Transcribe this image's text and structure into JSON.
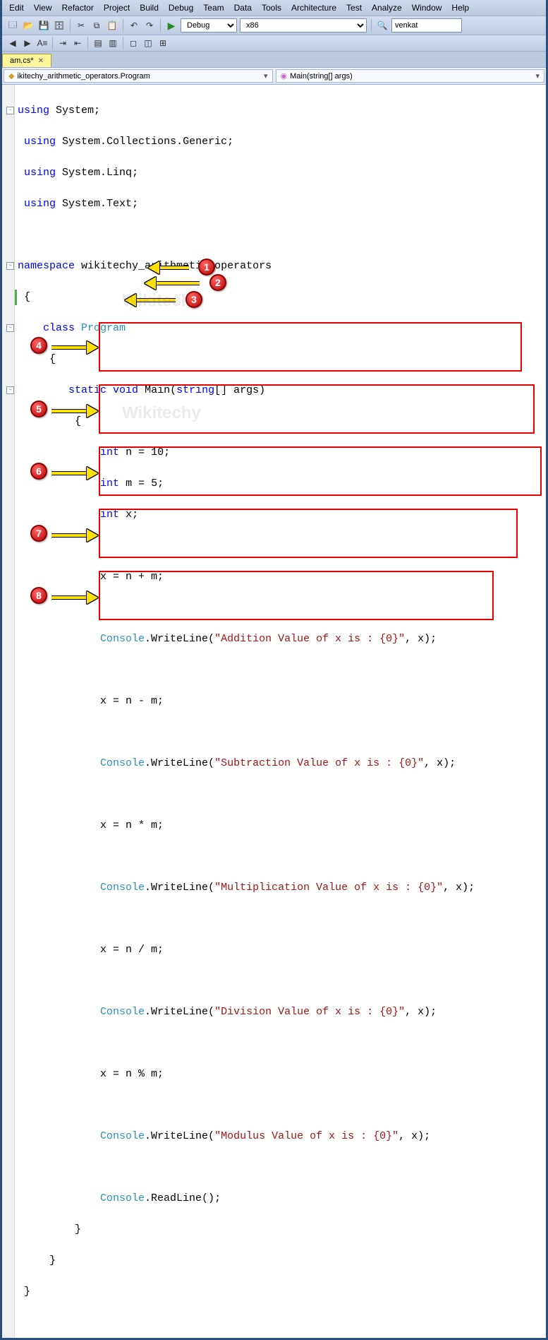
{
  "menu": [
    "Edit",
    "View",
    "Refactor",
    "Project",
    "Build",
    "Debug",
    "Team",
    "Data",
    "Tools",
    "Architecture",
    "Test",
    "Analyze",
    "Window",
    "Help"
  ],
  "toolbar": {
    "config_select": "Debug",
    "platform_select": "x86",
    "search_value": "venkat"
  },
  "tab": {
    "name": "am.cs*"
  },
  "nav": {
    "left": "ikitechy_arithmetic_operators.Program",
    "right": "Main(string[] args)"
  },
  "code": {
    "using1": "System",
    "using2": "System.Collections.Generic",
    "using3": "System.Linq",
    "using4": "System.Text",
    "ns": "wikitechy_arithmetic_operators",
    "cls": "Program",
    "mainSig": {
      "kw1": "static",
      "kw2": "void",
      "name": "Main",
      "argType": "string",
      "argName": "args"
    },
    "decl1": {
      "t": "int",
      "v": "n = 10;"
    },
    "decl2": {
      "t": "int",
      "v": "m = 5;"
    },
    "decl3": {
      "t": "int",
      "v": "x;"
    },
    "blocks": [
      {
        "expr": "x = n + m;",
        "cls": "Console",
        "fn": ".WriteLine(",
        "str": "\"Addition Value of x is : {0}\"",
        "tail": ", x);"
      },
      {
        "expr": "x = n - m;",
        "cls": "Console",
        "fn": ".WriteLine(",
        "str": "\"Subtraction Value of x is : {0}\"",
        "tail": ", x);"
      },
      {
        "expr": "x = n * m;",
        "cls": "Console",
        "fn": ".WriteLine(",
        "str": "\"Multiplication Value of x is : {0}\"",
        "tail": ", x);"
      },
      {
        "expr": "x = n / m;",
        "cls": "Console",
        "fn": ".WriteLine(",
        "str": "\"Division Value of x is : {0}\"",
        "tail": ", x);"
      },
      {
        "expr": "x = n % m;",
        "cls": "Console",
        "fn": ".WriteLine(",
        "str": "\"Modulus Value of x is : {0}\"",
        "tail": ", x);"
      }
    ],
    "readline": {
      "cls": "Console",
      "tail": ".ReadLine();"
    }
  },
  "markers": [
    "1",
    "2",
    "3",
    "4",
    "5",
    "6",
    "7",
    "8"
  ],
  "watermark": "Wikitechy"
}
